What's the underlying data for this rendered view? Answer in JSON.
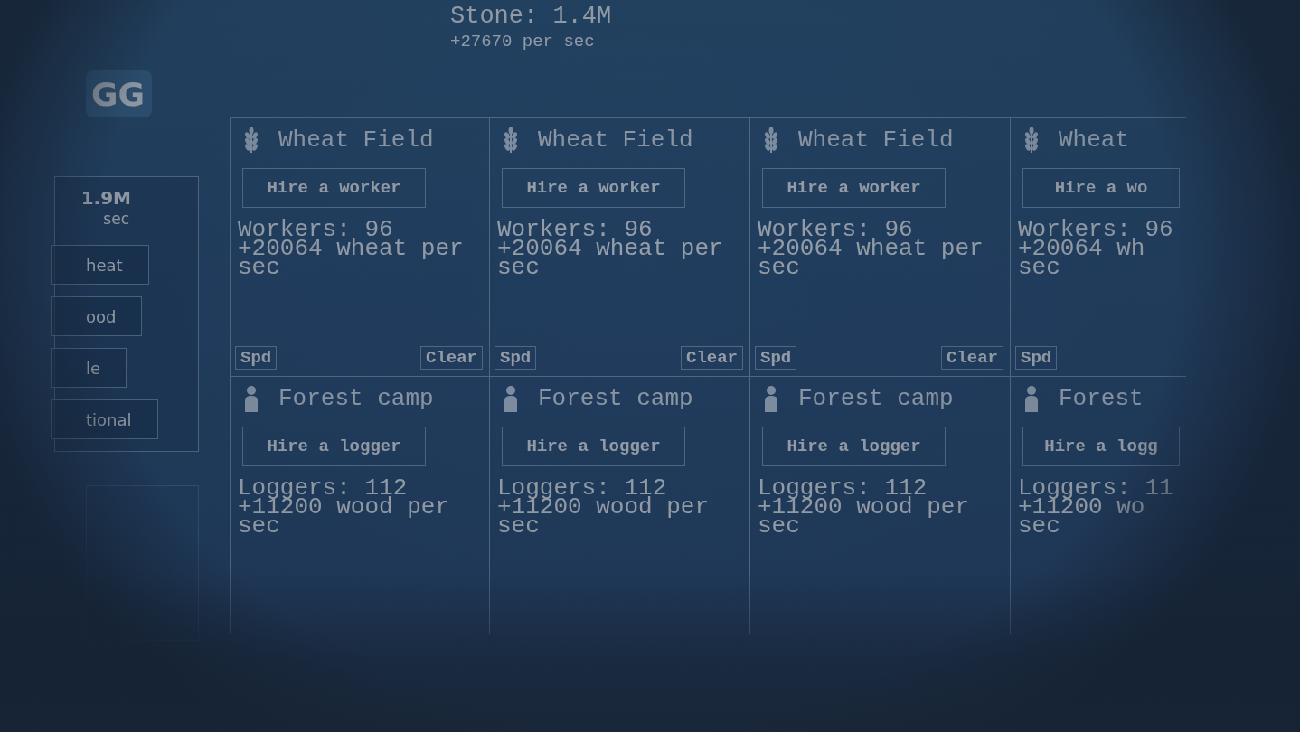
{
  "header": {
    "resource": "Stone: 1.4M",
    "rate": "+27670 per sec"
  },
  "logo": "GG",
  "sidebar": {
    "amount": "1.9M",
    "rate": "sec",
    "buttons": [
      {
        "label": "heat"
      },
      {
        "label": "ood"
      },
      {
        "label": "le"
      },
      {
        "label": "tional"
      }
    ]
  },
  "cards": [
    {
      "kind": "field",
      "title": "Wheat Field",
      "action": "Hire a worker",
      "count": "Workers: 96",
      "rate": "+20064 wheat per sec",
      "speed": "Spd",
      "clear": "Clear"
    },
    {
      "kind": "field",
      "title": "Wheat Field",
      "action": "Hire a worker",
      "count": "Workers: 96",
      "rate": "+20064 wheat per sec",
      "speed": "Spd",
      "clear": "Clear"
    },
    {
      "kind": "field",
      "title": "Wheat Field",
      "action": "Hire a worker",
      "count": "Workers: 96",
      "rate": "+20064 wheat per sec",
      "speed": "Spd",
      "clear": "Clear"
    },
    {
      "kind": "field",
      "title": "Wheat",
      "action": "Hire a wo",
      "count": "Workers: 96",
      "rate": "+20064 wh sec",
      "speed": "Spd"
    },
    {
      "kind": "camp",
      "title": "Forest camp",
      "action": "Hire a logger",
      "count": "Loggers: 112",
      "rate": "+11200 wood per sec"
    },
    {
      "kind": "camp",
      "title": "Forest camp",
      "action": "Hire a logger",
      "count": "Loggers: 112",
      "rate": "+11200 wood per sec"
    },
    {
      "kind": "camp",
      "title": "Forest camp",
      "action": "Hire a logger",
      "count": "Loggers: 112",
      "rate": "+11200 wood per sec"
    },
    {
      "kind": "camp",
      "title": "Forest",
      "action": "Hire a logg",
      "count": "Loggers: 11",
      "rate": "+11200 wo sec"
    }
  ]
}
